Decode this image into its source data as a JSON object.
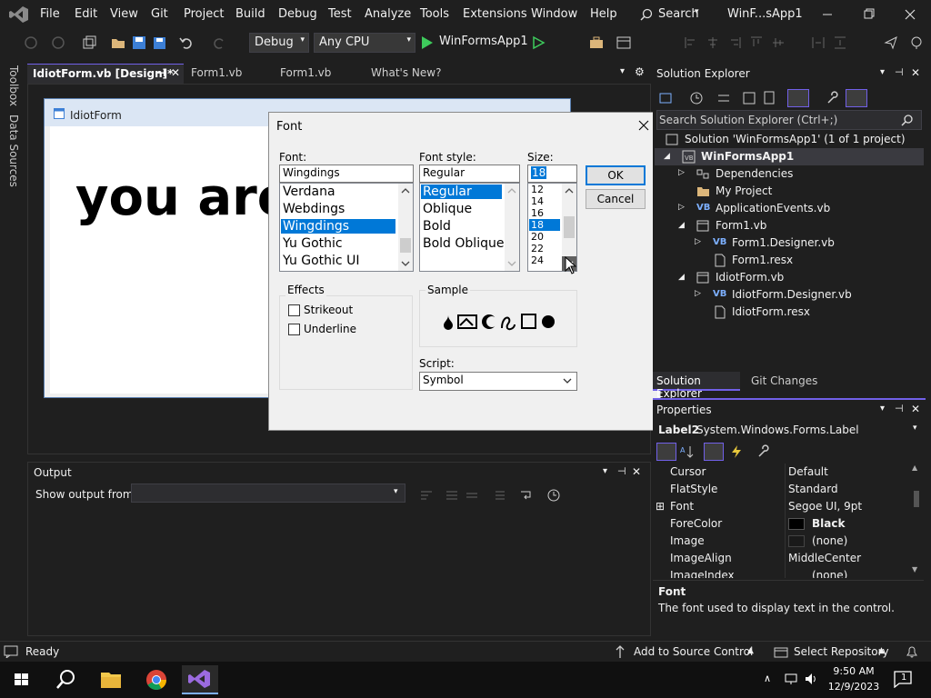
{
  "menu": [
    "File",
    "Edit",
    "View",
    "Git",
    "Project",
    "Build",
    "Debug",
    "Test",
    "Analyze",
    "Tools",
    "Extensions",
    "Window",
    "Help"
  ],
  "search_label": "Search",
  "window_title": "WinF...sApp1",
  "toolbar": {
    "config": "Debug",
    "platform": "Any CPU",
    "run_label": "WinFormsApp1"
  },
  "left_strip": [
    "Toolbox",
    "Data Sources"
  ],
  "doc_tabs": [
    "IdiotForm.vb [Design]*",
    "Form1.vb",
    "Form1.vb",
    "What's New?"
  ],
  "designer": {
    "form_title": "IdiotForm",
    "label_text": "you are"
  },
  "font_dialog": {
    "title": "Font",
    "font_label": "Font:",
    "font_value": "Wingdings",
    "font_list": [
      "Verdana",
      "Webdings",
      "Wingdings",
      "Yu Gothic",
      "Yu Gothic UI"
    ],
    "style_label": "Font style:",
    "style_value": "Regular",
    "style_list": [
      "Regular",
      "Oblique",
      "Bold",
      "Bold Oblique"
    ],
    "size_label": "Size:",
    "size_value": "18",
    "size_list": [
      "12",
      "14",
      "16",
      "18",
      "20",
      "22",
      "24"
    ],
    "ok": "OK",
    "cancel": "Cancel",
    "effects_label": "Effects",
    "strikeout": "Strikeout",
    "underline": "Underline",
    "sample_label": "Sample",
    "script_label": "Script:",
    "script_value": "Symbol"
  },
  "solution_explorer": {
    "title": "Solution Explorer",
    "search_placeholder": "Search Solution Explorer (Ctrl+;)",
    "solution": "Solution 'WinFormsApp1' (1 of 1 project)",
    "project": "WinFormsApp1",
    "items": [
      {
        "label": "Dependencies"
      },
      {
        "label": "My Project"
      },
      {
        "label": "ApplicationEvents.vb"
      },
      {
        "label": "Form1.vb"
      },
      {
        "label": "Form1.Designer.vb"
      },
      {
        "label": "Form1.resx"
      },
      {
        "label": "IdiotForm.vb"
      },
      {
        "label": "IdiotForm.Designer.vb"
      },
      {
        "label": "IdiotForm.resx"
      }
    ],
    "tab_active": "Solution Explorer",
    "tab_other": "Git Changes"
  },
  "properties": {
    "title": "Properties",
    "object": "Label2",
    "object_type": "System.Windows.Forms.Label",
    "rows": [
      {
        "name": "Cursor",
        "value": "Default"
      },
      {
        "name": "FlatStyle",
        "value": "Standard"
      },
      {
        "name": "Font",
        "value": "Segoe UI, 9pt"
      },
      {
        "name": "ForeColor",
        "value": "Black"
      },
      {
        "name": "Image",
        "value": "(none)"
      },
      {
        "name": "ImageAlign",
        "value": "MiddleCenter"
      },
      {
        "name": "ImageIndex",
        "value": "(none)"
      }
    ],
    "desc_title": "Font",
    "desc_text": "The font used to display text in the control."
  },
  "output": {
    "title": "Output",
    "show_from": "Show output from:"
  },
  "status": {
    "ready": "Ready",
    "source_control": "Add to Source Control",
    "repo": "Select Repository"
  },
  "taskbar": {
    "time": "9:50 AM",
    "date": "12/9/2023",
    "notif": "1"
  }
}
